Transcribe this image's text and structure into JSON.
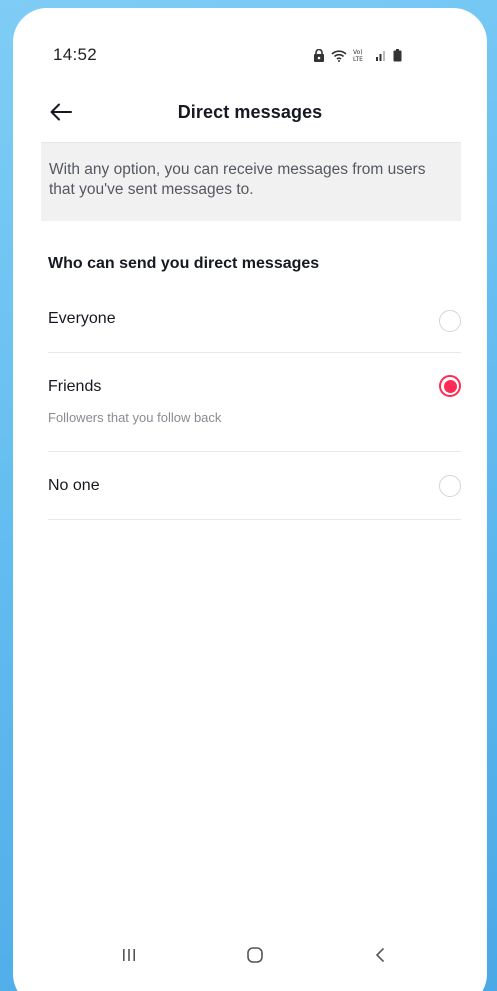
{
  "status_bar": {
    "time": "14:52",
    "icons": [
      "lock-icon",
      "wifi-icon",
      "volte-icon",
      "signal-icon",
      "battery-icon"
    ]
  },
  "header": {
    "title": "Direct messages",
    "back_icon": "arrow-left-icon"
  },
  "info": {
    "text": "With any option, you can receive messages from users that you've sent messages to."
  },
  "section": {
    "title": "Who can send you direct messages"
  },
  "options": [
    {
      "label": "Everyone",
      "subtitle": "",
      "selected": false
    },
    {
      "label": "Friends",
      "subtitle": "Followers that you follow back",
      "selected": true
    },
    {
      "label": "No one",
      "subtitle": "",
      "selected": false
    }
  ],
  "nav_bar": {
    "icons": [
      "recent-apps-icon",
      "home-icon",
      "back-icon"
    ]
  },
  "colors": {
    "accent": "#fe2c55",
    "background": "#64bdf0",
    "info_box": "#f1f1f2"
  }
}
